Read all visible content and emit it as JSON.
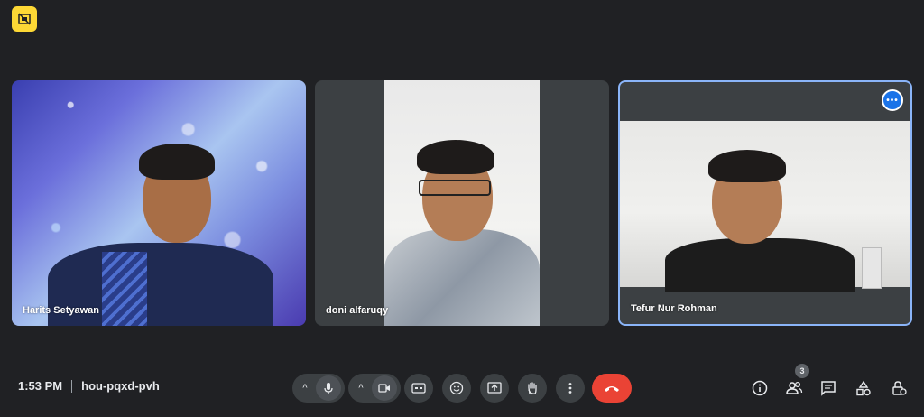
{
  "participants": [
    {
      "name": "Harits Setyawan"
    },
    {
      "name": "doni alfaruqy"
    },
    {
      "name": "Tefur Nur Rohman"
    }
  ],
  "meeting": {
    "time": "1:53 PM",
    "code": "hou-pqxd-pvh"
  },
  "people_count": "3",
  "colors": {
    "background": "#202124",
    "control_bg": "#3c4043",
    "end_call": "#ea4335",
    "active_border": "#8ab4f8",
    "badge": "#fdd835"
  },
  "controls": [
    "chevron-up-icon",
    "mic-icon",
    "chevron-up-icon",
    "camera-icon",
    "captions-icon",
    "emoji-icon",
    "present-icon",
    "raise-hand-icon",
    "more-vert-icon",
    "end-call-icon"
  ],
  "right_icons": [
    "info-icon",
    "people-icon",
    "chat-icon",
    "activities-icon",
    "host-controls-icon"
  ]
}
